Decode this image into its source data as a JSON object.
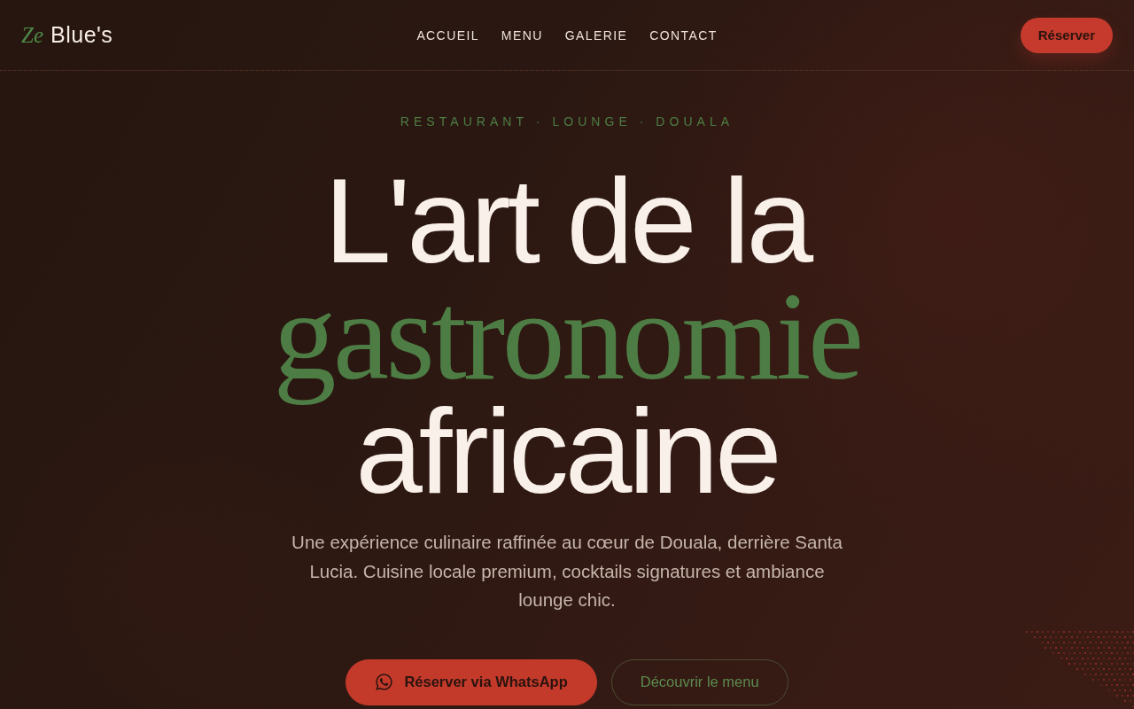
{
  "header": {
    "logo": {
      "accent": "Ze",
      "name": "Blue's"
    },
    "nav": [
      "ACCUEIL",
      "MENU",
      "GALERIE",
      "CONTACT"
    ],
    "cta": "Réserver"
  },
  "hero": {
    "eyebrow": "RESTAURANT · LOUNGE · DOUALA",
    "headline": [
      {
        "kind": "sans",
        "text": "L'art de la"
      },
      {
        "kind": "serif",
        "text": "gastronomie"
      },
      {
        "kind": "sans",
        "text": "africaine"
      }
    ],
    "description": "Une expérience culinaire raffinée au cœur de Douala, derrière Santa Lucia. Cuisine locale premium, cocktails signatures et ambiance lounge chic.",
    "actions": [
      {
        "kind": "primary",
        "label": "Réserver via WhatsApp"
      },
      {
        "kind": "outline",
        "label": "Découvrir le menu"
      }
    ]
  }
}
